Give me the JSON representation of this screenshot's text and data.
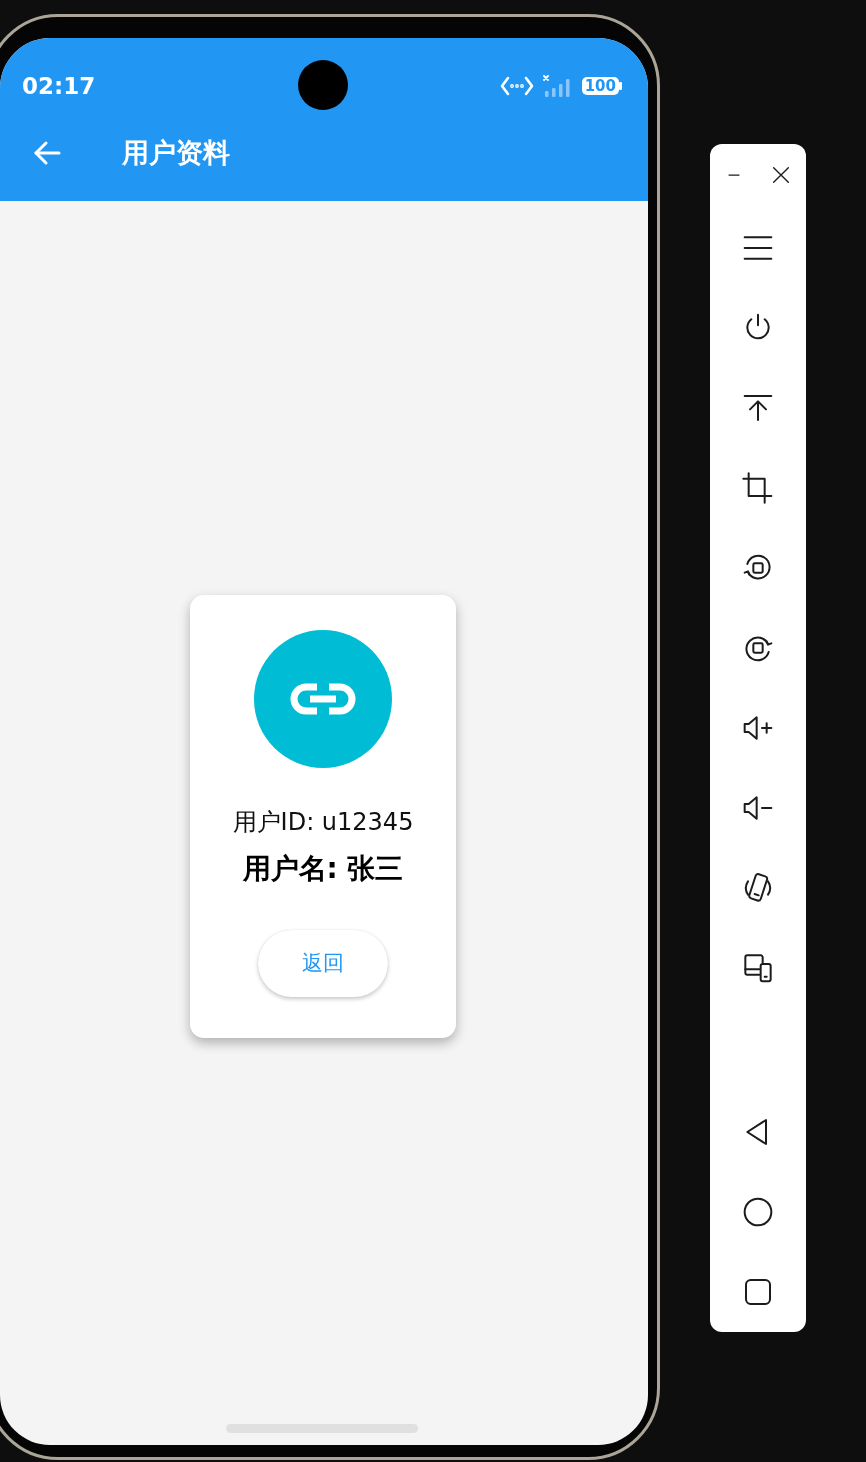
{
  "status_bar": {
    "time": "02:17",
    "battery": "100"
  },
  "app_bar": {
    "title": "用户资料"
  },
  "profile_card": {
    "user_id": "用户ID: u12345",
    "user_name": "用户名: 张三",
    "button": "返回"
  }
}
